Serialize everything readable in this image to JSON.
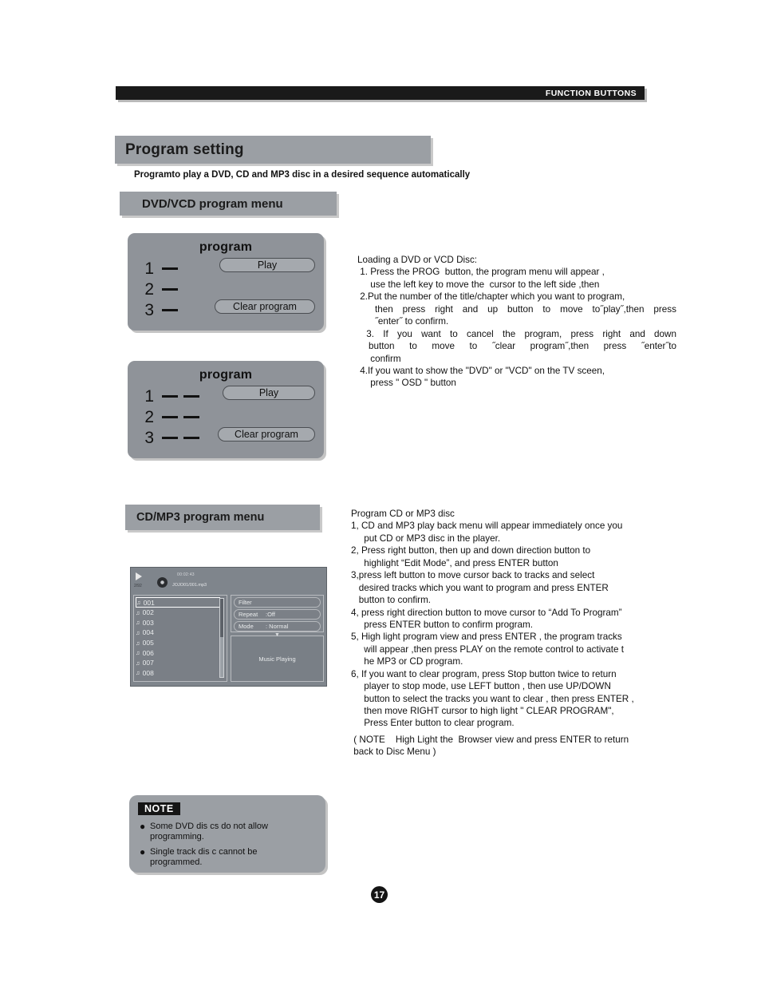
{
  "header": {
    "right_label": "FUNCTION BUTTONS"
  },
  "page": {
    "number": "17"
  },
  "section": {
    "title": "Program setting",
    "subtitle": "Programto play  a DVD, CD  and MP3 disc in a desired sequence automatically",
    "dvd_banner": "DVD/VCD program  menu",
    "cd_banner": "CD/MP3  program  menu"
  },
  "program_menu_1": {
    "title": "program",
    "rows": [
      {
        "num": "1",
        "dashes": 1
      },
      {
        "num": "2",
        "dashes": 1
      },
      {
        "num": "3",
        "dashes": 1
      }
    ],
    "play_label": "Play",
    "clear_label": "Clear  program"
  },
  "program_menu_2": {
    "title": "program",
    "rows": [
      {
        "num": "1",
        "dashes": 2
      },
      {
        "num": "2",
        "dashes": 2
      },
      {
        "num": "3",
        "dashes": 2
      }
    ],
    "play_label": "Play",
    "clear_label": "Clear  program"
  },
  "dvd_instructions": {
    "heading": "Loading a DVD or VCD Disc:",
    "l1": " 1. Press the PROG  button, the program menu will appear ,",
    "l2": "     use the left key to move the  cursor to the left side ,then",
    "l3": " 2.Put the number of the title/chapter which you want to program,",
    "l4": "then press right and up button to move to˝play˝,then press",
    "l5": "˝enter˝ to confirm.",
    "l6": " 3. If you want to cancel the program, press right and down",
    "l7": "button to move to ˝clear program˝,then press ˝enter˝to",
    "l8": "     confirm",
    "l9": " 4.If you want to show the \"DVD\" or \"VCD\" on the TV sceen,",
    "l10": "     press \" OSD \" button"
  },
  "cd_instructions": {
    "heading": "Program CD or MP3 disc",
    "l1": "1, CD and MP3 play back menu will appear immediately once you",
    "l2": "     put CD or MP3 disc in the player.",
    "l3": "2, Press right button, then up and down direction button to",
    "l4": "     highlight “Edit Mode”, and press ENTER button",
    "l5": "3,press left button to move cursor back to tracks and select",
    "l6": "   desired tracks which you want to program and press ENTER",
    "l7": "   button to confirm.",
    "l8": "4, press right direction button to move cursor to “Add To Program”",
    "l9": "     press ENTER button to confirm program.",
    "l10": "5, High light program view and press ENTER , the program tracks",
    "l11": "     will appear ,then press PLAY on the remote control to activate t",
    "l12": "     he MP3 or CD program.",
    "l13": "6, If you want to clear program, press Stop button twice to return",
    "l14": "     player to stop mode, use LEFT button , then use UP/DOWN",
    "l15": "     button to select the tracks you want to clear , then press ENTER ,",
    "l16": "     then move RIGHT cursor to high light \" CLEAR PROGRAM\",",
    "l17": "     Press Enter button to clear program.",
    "l18": " ( NOTE    High Light the  Browser view and press ENTER to return",
    "l19": " back to Disc Menu )"
  },
  "player_mock": {
    "track_counter": "2/92",
    "elapsed_time": "00:02:43",
    "file_name": "JOJO01/001.mp3",
    "tracks": [
      "001",
      "002",
      "003",
      "004",
      "005",
      "006",
      "007",
      "008"
    ],
    "selected_track": "001",
    "options": [
      {
        "key": "Filter",
        "value": ""
      },
      {
        "key": "Repeat",
        "value": ":Off"
      },
      {
        "key": "Mode",
        "value": ": Normal"
      }
    ],
    "now_playing": "Music Playing"
  },
  "note": {
    "tag": "NOTE",
    "items": [
      {
        "a": "Some DVD dis cs   do not allow",
        "b": "programming."
      },
      {
        "a": "Single track dis c  cannot be",
        "b": "programmed."
      }
    ]
  }
}
